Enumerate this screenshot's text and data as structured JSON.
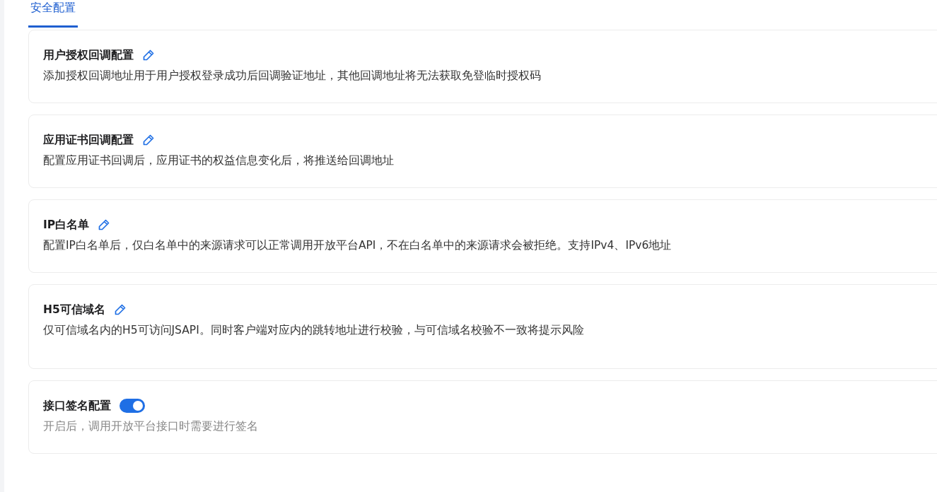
{
  "tabs": [
    {
      "label": "安全配置",
      "selected": true
    }
  ],
  "sections": [
    {
      "kind": "edit",
      "title": "用户授权回调配置",
      "description": "添加授权回调地址用于用户授权登录成功后回调验证地址，其他回调地址将无法获取免登临时授权码"
    },
    {
      "kind": "edit",
      "title": "应用证书回调配置",
      "description": "配置应用证书回调后，应用证书的权益信息变化后，将推送给回调地址"
    },
    {
      "kind": "edit",
      "title": "IP白名单",
      "description": "配置IP白名单后，仅白名单中的来源请求可以正常调用开放平台API，不在白名单中的来源请求会被拒绝。支持IPv4、IPv6地址"
    },
    {
      "kind": "edit",
      "title": "H5可信域名",
      "description": "仅可信域名内的H5可访问JSAPI。同时客户端对应内的跳转地址进行校验，与可信域名校验不一致将提示风险",
      "tall": true
    },
    {
      "kind": "toggle",
      "title": "接口签名配置",
      "on": true,
      "description": "开启后，调用开放平台接口时需要进行签名"
    }
  ]
}
